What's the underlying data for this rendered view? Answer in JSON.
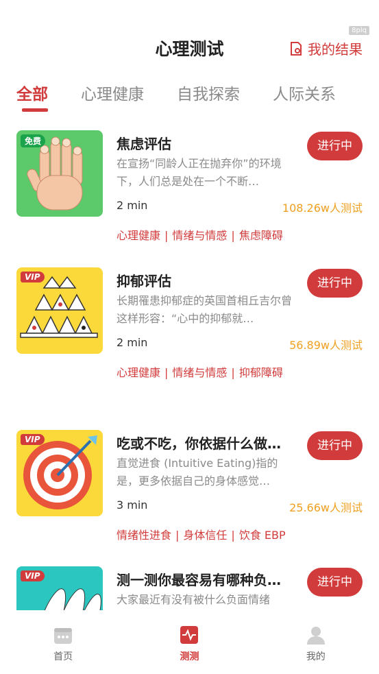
{
  "header": {
    "title": "心理测试",
    "my_results": "我的结果",
    "corner_tag": "8plq"
  },
  "tabs": [
    {
      "label": "全部"
    },
    {
      "label": "心理健康"
    },
    {
      "label": "自我探索"
    },
    {
      "label": "人际关系"
    }
  ],
  "cards": [
    {
      "badge": "免费",
      "title": "焦虑评估",
      "desc": "在宣扬“同龄人正在抛弃你”的环境下，人们总是处在一个不断…",
      "duration": "2 min",
      "count": "108.26w人测试",
      "tags": [
        "心理健康",
        "情绪与情感",
        "焦虑障碍"
      ],
      "button": "进行中"
    },
    {
      "badge": "VIP",
      "title": "抑郁评估",
      "desc": "长期罹患抑郁症的英国首相丘吉尔曾这样形容：“心中的抑郁就…",
      "duration": "2 min",
      "count": "56.89w人测试",
      "tags": [
        "心理健康",
        "情绪与情感",
        "抑郁障碍"
      ],
      "button": "进行中"
    },
    {
      "badge": "VIP",
      "title": "吃或不吃，你依据什么做…",
      "desc": "直觉进食 (Intuitive Eating)指的是，更多依据自己的身体感觉…",
      "duration": "3 min",
      "count": "25.66w人测试",
      "tags": [
        "情绪性进食",
        "身体信任",
        "饮食 EBP"
      ],
      "button": "进行中"
    },
    {
      "badge": "VIP",
      "title": "测一测你最容易有哪种负…",
      "desc": "大家最近有没有被什么负面情绪",
      "duration": "",
      "count": "",
      "tags": [],
      "button": "进行中"
    }
  ],
  "bottom_nav": [
    {
      "label": "首页"
    },
    {
      "label": "测测"
    },
    {
      "label": "我的"
    }
  ],
  "colors": {
    "accent": "#d23b3b",
    "count": "#f0a020",
    "free_badge": "#1aa34a"
  }
}
